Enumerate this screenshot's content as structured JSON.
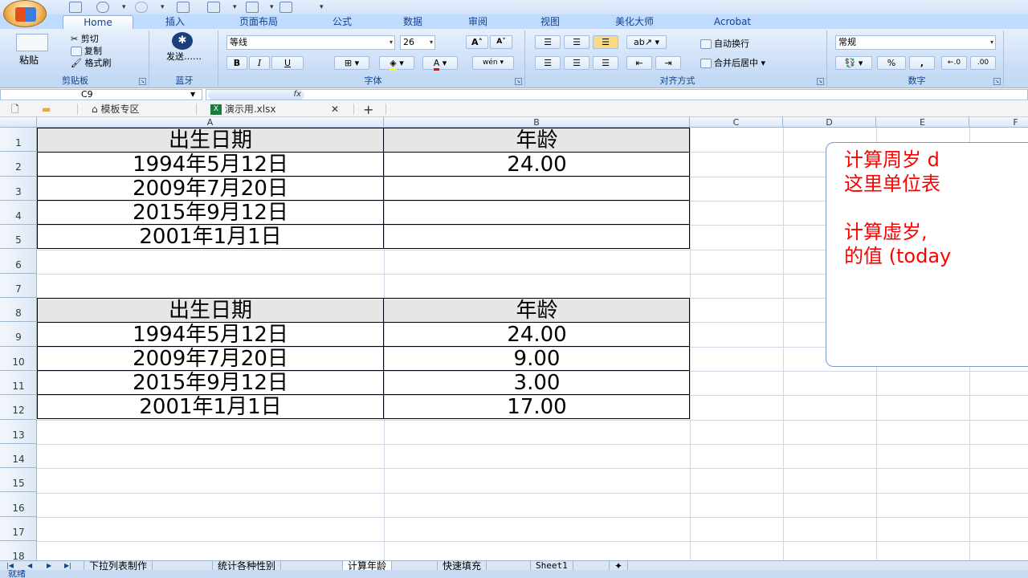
{
  "ribbon": {
    "tabs": [
      "Home",
      "插入",
      "页面布局",
      "公式",
      "数据",
      "审阅",
      "视图",
      "美化大师",
      "Acrobat"
    ],
    "active_tab": "Home",
    "clipboard": {
      "paste": "粘贴",
      "cut": "剪切",
      "copy": "复制",
      "format_painter": "格式刷",
      "label": "剪贴板"
    },
    "bluetooth": {
      "send": "发送……",
      "label": "蓝牙"
    },
    "font": {
      "name": "等线",
      "size": "26",
      "bold": "B",
      "italic": "I",
      "underline": "U",
      "grow": "A",
      "shrink": "A",
      "font_color": "A",
      "phonetic": "wén",
      "label": "字体"
    },
    "alignment": {
      "wrap": "自动换行",
      "merge": "合并后居中",
      "label": "对齐方式"
    },
    "number": {
      "format": "常规",
      "percent": "%",
      "comma": ",",
      "label": "数字"
    }
  },
  "formula_bar": {
    "name_box": "C9",
    "fx": "fx"
  },
  "doc_tabs": {
    "template": "模板专区",
    "file": "演示用.xlsx",
    "close": "✕",
    "new": "+"
  },
  "columns": [
    "A",
    "B",
    "C",
    "D",
    "E",
    "F"
  ],
  "rows": [
    "1",
    "2",
    "3",
    "4",
    "5",
    "6",
    "7",
    "8",
    "9",
    "10",
    "11",
    "12",
    "13",
    "14",
    "15",
    "16",
    "17",
    "18"
  ],
  "table1": {
    "header": [
      "出生日期",
      "年龄"
    ],
    "rows": [
      [
        "1994年5月12日",
        "24.00"
      ],
      [
        "2009年7月20日",
        ""
      ],
      [
        "2015年9月12日",
        ""
      ],
      [
        "2001年1月1日",
        ""
      ]
    ]
  },
  "table2": {
    "header": [
      "出生日期",
      "年龄"
    ],
    "rows": [
      [
        "1994年5月12日",
        "24.00"
      ],
      [
        "2009年7月20日",
        "9.00"
      ],
      [
        "2015年9月12日",
        "3.00"
      ],
      [
        "2001年1月1日",
        "17.00"
      ]
    ]
  },
  "note": {
    "line1": "计算周岁 d",
    "line2": "这里单位表",
    "line3": "计算虚岁,",
    "line4": "的值 (today"
  },
  "sheets": [
    "下拉列表制作",
    "统计各种性别",
    "计算年龄",
    "快速填充",
    "Sheet1"
  ],
  "active_sheet": "计算年龄",
  "status": "就绪",
  "colors": {
    "accent": "#15428b",
    "note_text": "#ff0000",
    "header_fill": "#e6e6e6"
  }
}
